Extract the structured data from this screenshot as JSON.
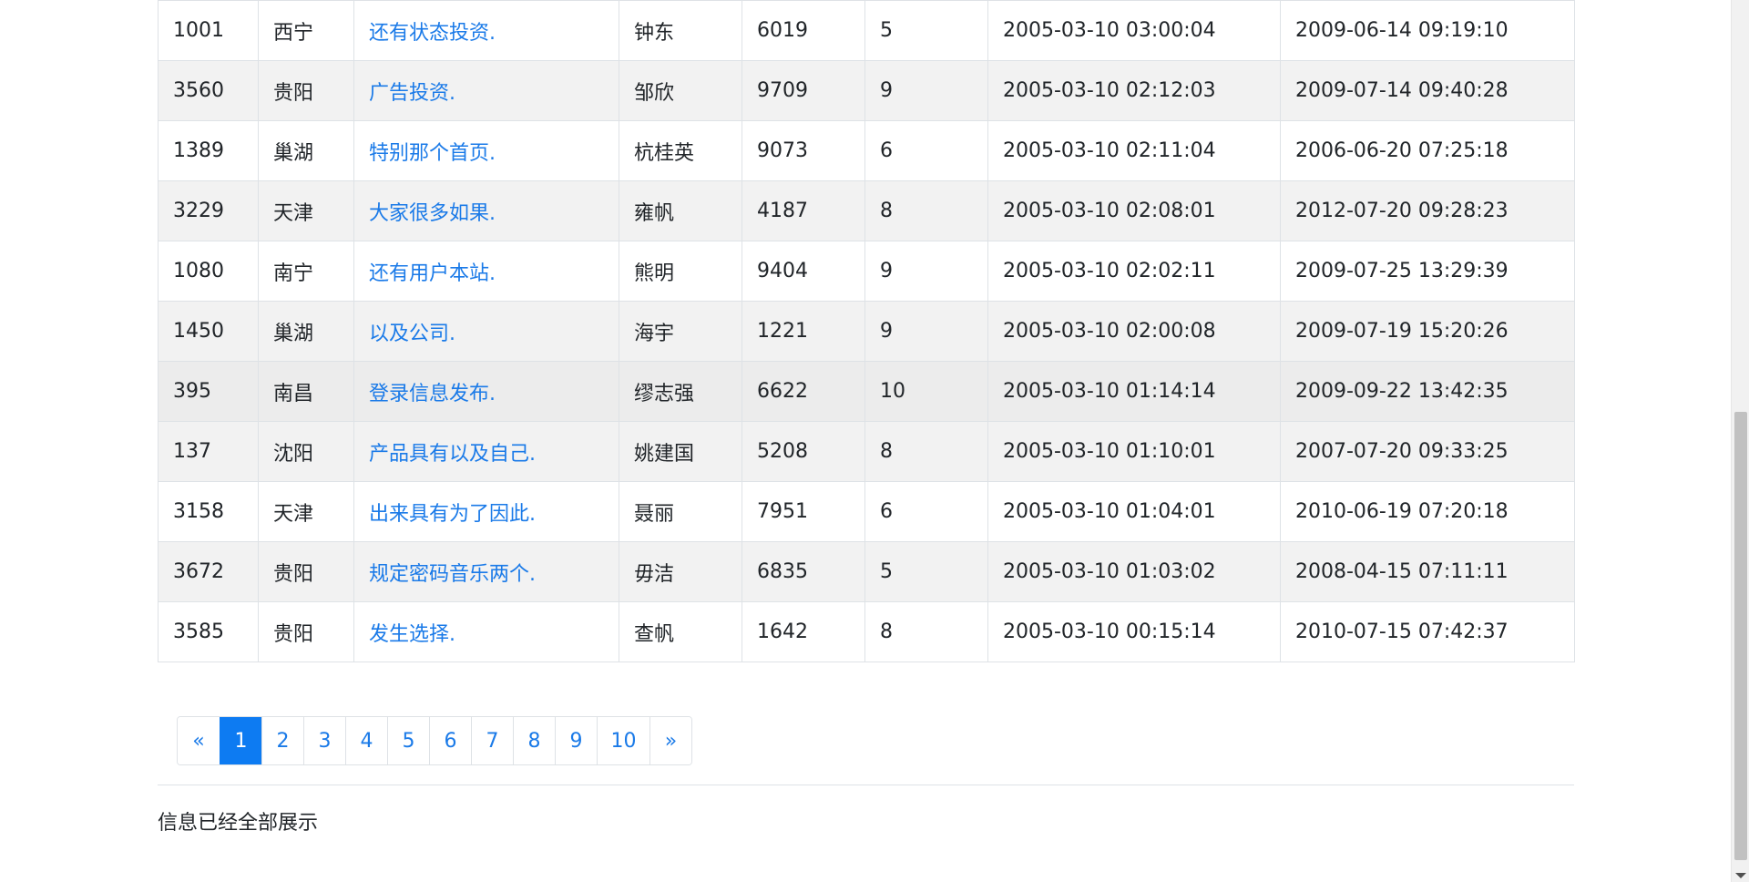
{
  "table": {
    "rows": [
      {
        "id": "1001",
        "city": "西宁",
        "title": "还有状态投资.",
        "name": "钟东",
        "views": "6019",
        "level": "5",
        "created": "2005-03-10 03:00:04",
        "updated": "2009-06-14 09:19:10"
      },
      {
        "id": "3560",
        "city": "贵阳",
        "title": "广告投资.",
        "name": "邹欣",
        "views": "9709",
        "level": "9",
        "created": "2005-03-10 02:12:03",
        "updated": "2009-07-14 09:40:28"
      },
      {
        "id": "1389",
        "city": "巢湖",
        "title": "特别那个首页.",
        "name": "杭桂英",
        "views": "9073",
        "level": "6",
        "created": "2005-03-10 02:11:04",
        "updated": "2006-06-20 07:25:18"
      },
      {
        "id": "3229",
        "city": "天津",
        "title": "大家很多如果.",
        "name": "雍帆",
        "views": "4187",
        "level": "8",
        "created": "2005-03-10 02:08:01",
        "updated": "2012-07-20 09:28:23"
      },
      {
        "id": "1080",
        "city": "南宁",
        "title": "还有用户本站.",
        "name": "熊明",
        "views": "9404",
        "level": "9",
        "created": "2005-03-10 02:02:11",
        "updated": "2009-07-25 13:29:39"
      },
      {
        "id": "1450",
        "city": "巢湖",
        "title": "以及公司.",
        "name": "海宇",
        "views": "1221",
        "level": "9",
        "created": "2005-03-10 02:00:08",
        "updated": "2009-07-19 15:20:26"
      },
      {
        "id": "395",
        "city": "南昌",
        "title": "登录信息发布.",
        "name": "缪志强",
        "views": "6622",
        "level": "10",
        "created": "2005-03-10 01:14:14",
        "updated": "2009-09-22 13:42:35"
      },
      {
        "id": "137",
        "city": "沈阳",
        "title": "产品具有以及自己.",
        "name": "姚建国",
        "views": "5208",
        "level": "8",
        "created": "2005-03-10 01:10:01",
        "updated": "2007-07-20 09:33:25"
      },
      {
        "id": "3158",
        "city": "天津",
        "title": "出来具有为了因此.",
        "name": "聂丽",
        "views": "7951",
        "level": "6",
        "created": "2005-03-10 01:04:01",
        "updated": "2010-06-19 07:20:18"
      },
      {
        "id": "3672",
        "city": "贵阳",
        "title": "规定密码音乐两个.",
        "name": "毋洁",
        "views": "6835",
        "level": "5",
        "created": "2005-03-10 01:03:02",
        "updated": "2008-04-15 07:11:11"
      },
      {
        "id": "3585",
        "city": "贵阳",
        "title": "发生选择.",
        "name": "查帆",
        "views": "1642",
        "level": "8",
        "created": "2005-03-10 00:15:14",
        "updated": "2010-07-15 07:42:37"
      }
    ]
  },
  "pagination": {
    "prev_label": "«",
    "next_label": "»",
    "pages": [
      "1",
      "2",
      "3",
      "4",
      "5",
      "6",
      "7",
      "8",
      "9",
      "10"
    ],
    "active_page": "1"
  },
  "footer": {
    "note": "信息已经全部展示"
  },
  "colors": {
    "link": "#1a7ae8",
    "active_page_bg": "#0d7bf2",
    "stripe": "#f2f2f2",
    "border": "#dee2e6"
  }
}
